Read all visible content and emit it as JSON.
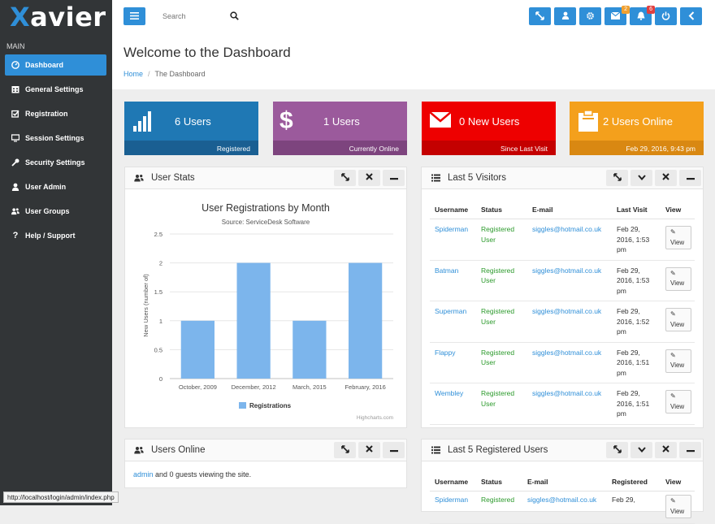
{
  "brand": {
    "first": "X",
    "rest": "avier"
  },
  "search": {
    "placeholder": "Search"
  },
  "topbar": {
    "mail_badge": "2",
    "bell_badge": "6"
  },
  "sidebar": {
    "heading": "MAIN",
    "items": [
      {
        "label": "Dashboard",
        "icon": "dashboard-icon"
      },
      {
        "label": "General Settings",
        "icon": "calendar-icon"
      },
      {
        "label": "Registration",
        "icon": "checkbox-icon"
      },
      {
        "label": "Session Settings",
        "icon": "monitor-icon"
      },
      {
        "label": "Security Settings",
        "icon": "key-icon"
      },
      {
        "label": "User Admin",
        "icon": "user-icon"
      },
      {
        "label": "User Groups",
        "icon": "users-icon"
      },
      {
        "label": "Help / Support",
        "icon": "question-icon"
      }
    ]
  },
  "page": {
    "title": "Welcome to the Dashboard",
    "crumb_home": "Home",
    "crumb_current": "The Dashboard"
  },
  "stats": [
    {
      "value": "6 Users",
      "footer": "Registered",
      "color": "#1f78b4",
      "footer_color": "#1a5f92"
    },
    {
      "value": "1 Users",
      "footer": "Currently Online",
      "color": "#9b5a9c",
      "footer_color": "#7d447e"
    },
    {
      "value": "0 New Users",
      "footer": "Since Last Visit",
      "color": "#ee0000",
      "footer_color": "#c40000"
    },
    {
      "value": "2 Users Online",
      "footer": "Feb 29, 2016, 9:43 pm",
      "color": "#f4a01c",
      "footer_color": "#d98812"
    }
  ],
  "panels": {
    "user_stats": "User Stats",
    "visitors": "Last 5 Visitors",
    "online": "Users Online",
    "registered": "Last 5 Registered Users"
  },
  "online": {
    "user": "admin",
    "text": " and 0 guests viewing the site."
  },
  "visitors_table": {
    "headers": [
      "Username",
      "Status",
      "E-mail",
      "Last Visit",
      "View"
    ],
    "rows": [
      {
        "user": "Spiderman",
        "status": "Registered User",
        "email": "siggles@hotmail.co.uk",
        "last": "Feb 29, 2016, 1:53 pm",
        "view": "View"
      },
      {
        "user": "Batman",
        "status": "Registered User",
        "email": "siggles@hotmail.co.uk",
        "last": "Feb 29, 2016, 1:53 pm",
        "view": "View"
      },
      {
        "user": "Superman",
        "status": "Registered User",
        "email": "siggles@hotmail.co.uk",
        "last": "Feb 29, 2016, 1:52 pm",
        "view": "View"
      },
      {
        "user": "Flappy",
        "status": "Registered User",
        "email": "siggles@hotmail.co.uk",
        "last": "Feb 29, 2016, 1:51 pm",
        "view": "View"
      },
      {
        "user": "Wembley",
        "status": "Registered User",
        "email": "siggles@hotmail.co.uk",
        "last": "Feb 29, 2016, 1:51 pm",
        "view": "View"
      }
    ]
  },
  "registered_table": {
    "headers": [
      "Username",
      "Status",
      "E-mail",
      "Registered",
      "View"
    ],
    "rows": [
      {
        "user": "Spiderman",
        "status": "Registered",
        "email": "siggles@hotmail.co.uk",
        "date": "Feb 29,",
        "view": "View"
      }
    ]
  },
  "statusbar": "http://localhost/login/admin/index.php",
  "chart_data": {
    "type": "bar",
    "title": "User Registrations by Month",
    "subtitle": "Source: ServiceDesk Software",
    "ylabel": "New Users (number of)",
    "categories": [
      "October, 2009",
      "December, 2012",
      "March, 2015",
      "February, 2016"
    ],
    "series": [
      {
        "name": "Registrations",
        "values": [
          1,
          2,
          1,
          2
        ],
        "color": "#7cb5ec"
      }
    ],
    "ylim": [
      0,
      2.5
    ],
    "yticks": [
      "0",
      "0.5",
      "1",
      "1.5",
      "2",
      "2.5"
    ],
    "grid": true,
    "legend": "bottom",
    "credits": "Highcharts.com"
  }
}
